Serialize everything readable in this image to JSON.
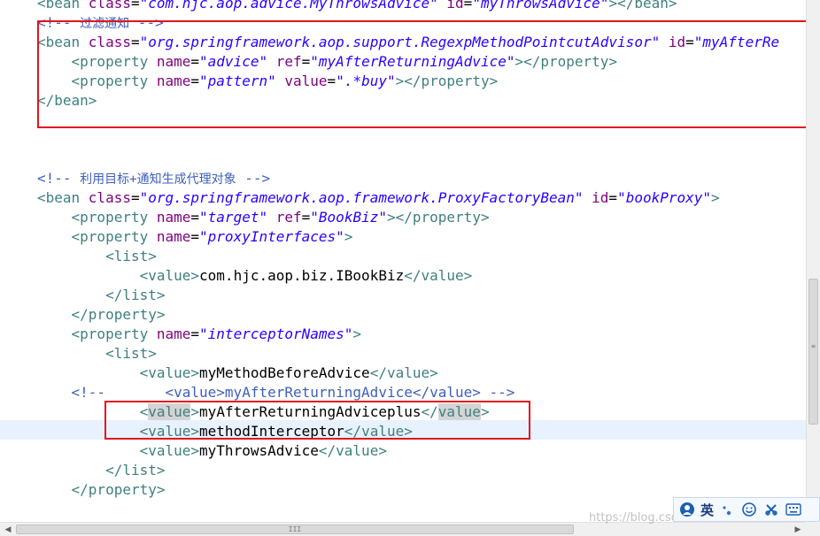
{
  "editor": {
    "lines": [
      [
        [
          "tag",
          "<bean "
        ],
        [
          "attr",
          "class"
        ],
        [
          "txt",
          "="
        ],
        [
          "val",
          "\"com.hjc.aop.advice.MyThrowsAdvice\""
        ],
        [
          "txt",
          " "
        ],
        [
          "attr",
          "id"
        ],
        [
          "txt",
          "="
        ],
        [
          "val",
          "\"myThrowsAdvice\""
        ],
        [
          "tag",
          "></bean>"
        ]
      ],
      [
        [
          "cmt",
          "<!-- "
        ],
        [
          "cmt-cn",
          "过滤通知"
        ],
        [
          "cmt",
          " -->"
        ]
      ],
      [
        [
          "tag",
          "<bean "
        ],
        [
          "attr",
          "class"
        ],
        [
          "txt",
          "="
        ],
        [
          "val",
          "\"org.springframework.aop.support.RegexpMethodPointcutAdvisor\""
        ],
        [
          "txt",
          " "
        ],
        [
          "attr",
          "id"
        ],
        [
          "txt",
          "="
        ],
        [
          "val",
          "\"myAfterRe"
        ]
      ],
      [
        [
          "txt",
          "    "
        ],
        [
          "tag",
          "<property "
        ],
        [
          "attr",
          "name"
        ],
        [
          "txt",
          "="
        ],
        [
          "val",
          "\"advice\""
        ],
        [
          "txt",
          " "
        ],
        [
          "attr",
          "ref"
        ],
        [
          "txt",
          "="
        ],
        [
          "val",
          "\"myAfterReturningAdvice\""
        ],
        [
          "tag",
          "></property>"
        ]
      ],
      [
        [
          "txt",
          "    "
        ],
        [
          "tag",
          "<property "
        ],
        [
          "attr",
          "name"
        ],
        [
          "txt",
          "="
        ],
        [
          "val",
          "\"pattern\""
        ],
        [
          "txt",
          " "
        ],
        [
          "attr",
          "value"
        ],
        [
          "txt",
          "="
        ],
        [
          "val",
          "\".*buy\""
        ],
        [
          "tag",
          "></property>"
        ]
      ],
      [
        [
          "tag",
          "</bean>"
        ]
      ],
      [],
      [],
      [],
      [
        [
          "cmt",
          "<!-- "
        ],
        [
          "cmt-cn",
          "利用目标+通知生成代理对象"
        ],
        [
          "cmt",
          " -->"
        ]
      ],
      [
        [
          "tag",
          "<bean "
        ],
        [
          "attr",
          "class"
        ],
        [
          "txt",
          "="
        ],
        [
          "val",
          "\"org.springframework.aop.framework.ProxyFactoryBean\""
        ],
        [
          "txt",
          " "
        ],
        [
          "attr",
          "id"
        ],
        [
          "txt",
          "="
        ],
        [
          "val",
          "\"bookProxy\""
        ],
        [
          "tag",
          ">"
        ]
      ],
      [
        [
          "txt",
          "    "
        ],
        [
          "tag",
          "<property "
        ],
        [
          "attr",
          "name"
        ],
        [
          "txt",
          "="
        ],
        [
          "val",
          "\"target\""
        ],
        [
          "txt",
          " "
        ],
        [
          "attr",
          "ref"
        ],
        [
          "txt",
          "="
        ],
        [
          "val",
          "\"BookBiz\""
        ],
        [
          "tag",
          "></property>"
        ]
      ],
      [
        [
          "txt",
          "    "
        ],
        [
          "tag",
          "<property "
        ],
        [
          "attr",
          "name"
        ],
        [
          "txt",
          "="
        ],
        [
          "val",
          "\"proxyInterfaces\""
        ],
        [
          "tag",
          ">"
        ]
      ],
      [
        [
          "txt",
          "        "
        ],
        [
          "tag",
          "<list>"
        ]
      ],
      [
        [
          "txt",
          "            "
        ],
        [
          "tag",
          "<value>"
        ],
        [
          "txt",
          "com.hjc.aop.biz.IBookBiz"
        ],
        [
          "tag",
          "</value>"
        ]
      ],
      [
        [
          "txt",
          "        "
        ],
        [
          "tag",
          "</list>"
        ]
      ],
      [
        [
          "txt",
          "    "
        ],
        [
          "tag",
          "</property>"
        ]
      ],
      [
        [
          "txt",
          "    "
        ],
        [
          "tag",
          "<property "
        ],
        [
          "attr",
          "name"
        ],
        [
          "txt",
          "="
        ],
        [
          "val",
          "\"interceptorNames\""
        ],
        [
          "tag",
          ">"
        ]
      ],
      [
        [
          "txt",
          "        "
        ],
        [
          "tag",
          "<list>"
        ]
      ],
      [
        [
          "txt",
          "            "
        ],
        [
          "tag",
          "<value>"
        ],
        [
          "txt",
          "myMethodBeforeAdvice"
        ],
        [
          "tag",
          "</value>"
        ]
      ],
      [
        [
          "txt",
          "    "
        ],
        [
          "cmt",
          "<!--       <value>myAfterReturningAdvice</value> -->"
        ]
      ],
      [
        [
          "txt",
          "            "
        ],
        [
          "tag",
          "<"
        ],
        [
          "tag hl",
          "value"
        ],
        [
          "tag",
          ">"
        ],
        [
          "txt",
          "myAfterReturningAdviceplus"
        ],
        [
          "tag",
          "</"
        ],
        [
          "tag hl",
          "value"
        ],
        [
          "tag",
          ">"
        ]
      ],
      [
        [
          "txt",
          "            "
        ],
        [
          "tag",
          "<value>"
        ],
        [
          "txt",
          "methodInterceptor"
        ],
        [
          "tag",
          "</value>"
        ]
      ],
      [
        [
          "txt",
          "            "
        ],
        [
          "tag",
          "<value>"
        ],
        [
          "txt",
          "myThrowsAdvice"
        ],
        [
          "tag",
          "</value>"
        ]
      ],
      [
        [
          "txt",
          "        "
        ],
        [
          "tag",
          "</list>"
        ]
      ],
      [
        [
          "txt",
          "    "
        ],
        [
          "tag",
          "</property>"
        ]
      ]
    ]
  },
  "ime": {
    "lang_label": "英",
    "icons": [
      "ime-logo-icon",
      "punctuation-icon",
      "emoji-icon",
      "tools-icon",
      "keyboard-icon"
    ]
  },
  "watermark": "https://blog.csdn.net/...",
  "hscroll_grip": "III",
  "vscroll_grip": "≡"
}
